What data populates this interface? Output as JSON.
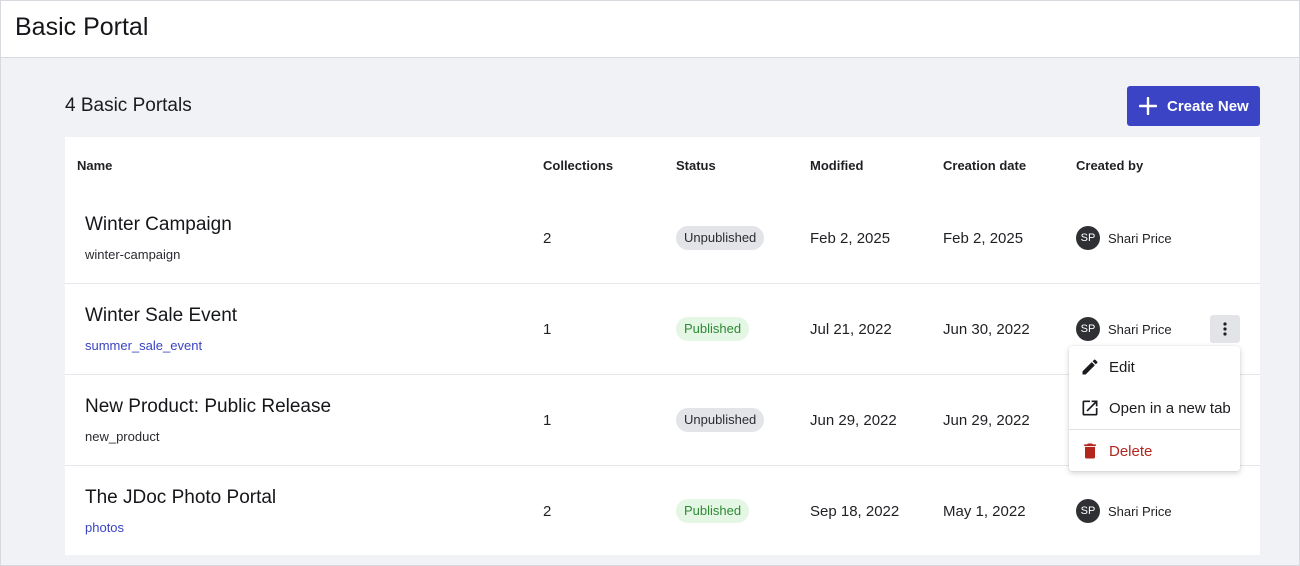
{
  "app": {
    "title": "Basic Portal"
  },
  "page": {
    "heading": "4 Basic Portals",
    "create_label": "Create New"
  },
  "colors": {
    "accent": "#3a44c4",
    "published": "#2e8a35",
    "danger": "#b3261e"
  },
  "table": {
    "columns": [
      "Name",
      "Collections",
      "Status",
      "Modified",
      "Creation date",
      "Created by"
    ],
    "rows": [
      {
        "name": "Winter Campaign",
        "slug": "winter-campaign",
        "collections": "2",
        "status": "Unpublished",
        "modified": "Feb 2, 2025",
        "created": "Feb 2, 2025",
        "initials": "SP",
        "creator": "Shari Price"
      },
      {
        "name": "Winter Sale Event",
        "slug": "summer_sale_event",
        "collections": "1",
        "status": "Published",
        "modified": "Jul 21, 2022",
        "created": "Jun 30, 2022",
        "initials": "SP",
        "creator": "Shari Price"
      },
      {
        "name": "New Product: Public Release",
        "slug": "new_product",
        "collections": "1",
        "status": "Unpublished",
        "modified": "Jun 29, 2022",
        "created": "Jun 29, 2022"
      },
      {
        "name": "The JDoc Photo Portal",
        "slug": "photos",
        "collections": "2",
        "status": "Published",
        "modified": "Sep 18, 2022",
        "created": "May 1, 2022",
        "initials": "SP",
        "creator": "Shari Price"
      }
    ]
  },
  "menu": {
    "edit": "Edit",
    "open_new_tab": "Open in a new tab",
    "delete": "Delete"
  },
  "icons": {
    "create": "plus-icon",
    "row_actions": "more-vertical-icon",
    "edit": "pencil-icon",
    "open_new_tab": "external-link-icon",
    "delete": "trash-icon"
  }
}
